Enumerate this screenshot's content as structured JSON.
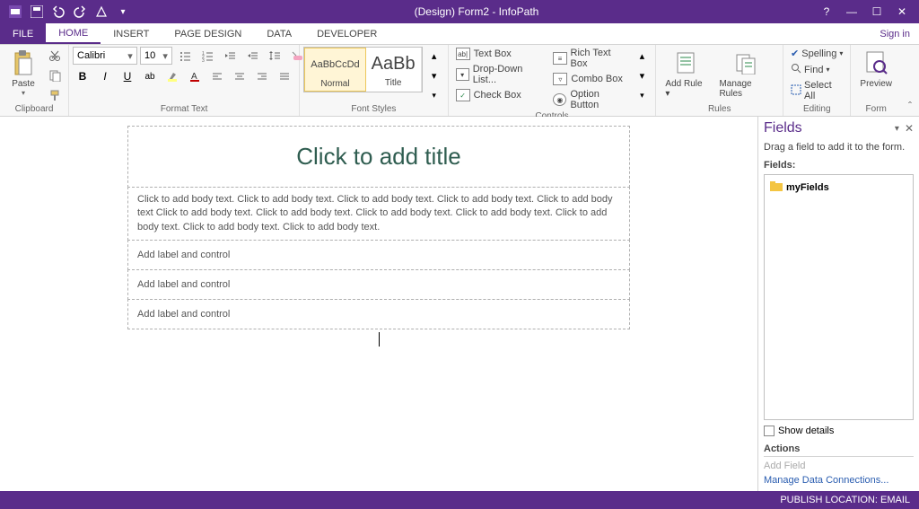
{
  "titlebar": {
    "title": "(Design) Form2 - InfoPath"
  },
  "tabs": {
    "file": "FILE",
    "home": "HOME",
    "insert": "INSERT",
    "page_design": "PAGE DESIGN",
    "data": "DATA",
    "developer": "DEVELOPER",
    "signin": "Sign in"
  },
  "ribbon": {
    "clipboard": {
      "paste": "Paste",
      "group_label": "Clipboard"
    },
    "format": {
      "font_name": "Calibri",
      "font_size": "10",
      "bold": "B",
      "italic": "I",
      "underline": "U",
      "group_label": "Format Text"
    },
    "styles": {
      "normal_preview": "AaBbCcDd",
      "normal_label": "Normal",
      "title_preview": "AaBb",
      "title_label": "Title",
      "group_label": "Font Styles"
    },
    "controls": {
      "textbox": "Text Box",
      "dropdown": "Drop-Down List...",
      "checkbox": "Check Box",
      "richtext": "Rich Text Box",
      "combobox": "Combo Box",
      "option": "Option Button",
      "group_label": "Controls"
    },
    "rules": {
      "add_rule": "Add Rule",
      "manage_rules": "Manage Rules",
      "group_label": "Rules"
    },
    "editing": {
      "spelling": "Spelling",
      "find": "Find",
      "select_all": "Select All",
      "group_label": "Editing"
    },
    "form": {
      "preview": "Preview",
      "group_label": "Form"
    }
  },
  "canvas": {
    "title_placeholder": "Click to add title",
    "body_placeholder": "Click to add body text. Click to add body text. Click to add body text. Click to add body text. Click to add body text Click to add body text. Click to add body text. Click to add body text. Click to add body text. Click to add body text. Click to add body text. Click to add body text.",
    "label_placeholder_1": "Add label and control",
    "label_placeholder_2": "Add label and control",
    "label_placeholder_3": "Add label and control"
  },
  "fields_pane": {
    "title": "Fields",
    "description": "Drag a field to add it to the form.",
    "label": "Fields:",
    "root": "myFields",
    "show_details": "Show details",
    "actions_header": "Actions",
    "add_field": "Add Field",
    "manage_connections": "Manage Data Connections..."
  },
  "statusbar": {
    "publish": "PUBLISH LOCATION: EMAIL"
  }
}
